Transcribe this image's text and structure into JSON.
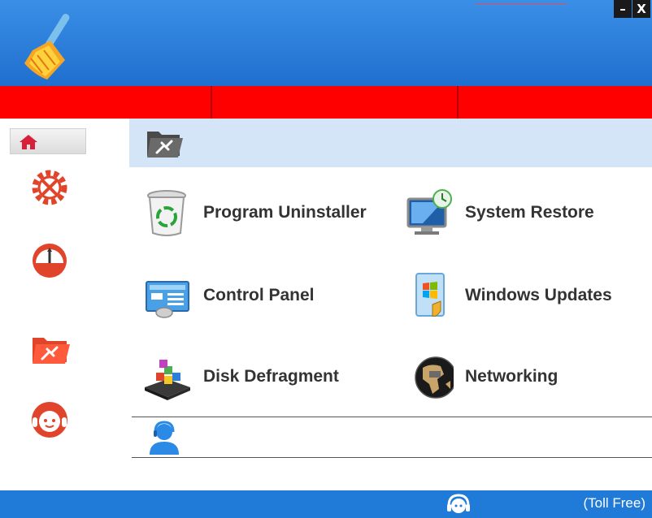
{
  "window": {
    "minimize_label": "–",
    "close_label": "X"
  },
  "header": {
    "logo_icon": "broom-icon"
  },
  "navbar": {
    "color": "#ff0000",
    "tabs": [
      "",
      "",
      ""
    ]
  },
  "sidebar": {
    "items": [
      {
        "icon": "home-icon"
      },
      {
        "icon": "gear-tools-icon"
      },
      {
        "icon": "speedometer-icon"
      },
      {
        "icon": "folder-tools-icon"
      },
      {
        "icon": "support-agent-icon"
      }
    ]
  },
  "main": {
    "band_icon": "folder-tools-icon",
    "tools": [
      {
        "label": "Program Uninstaller",
        "icon": "recycle-bin-icon"
      },
      {
        "label": "System Restore",
        "icon": "monitor-restore-icon"
      },
      {
        "label": "Control Panel",
        "icon": "control-panel-icon"
      },
      {
        "label": "Windows Updates",
        "icon": "windows-update-icon"
      },
      {
        "label": "Disk Defragment",
        "icon": "disk-defragment-icon"
      },
      {
        "label": "Networking",
        "icon": "globe-icon"
      }
    ],
    "support_icon": "support-person-icon"
  },
  "footer": {
    "toll_free": "(Toll Free)",
    "icon": "headset-icon"
  },
  "colors": {
    "header_blue": "#2a7fdd",
    "nav_red": "#ff0000",
    "band_blue": "#d3e5f7",
    "footer_blue": "#1f7ad8",
    "accent_red": "#e0442a"
  }
}
